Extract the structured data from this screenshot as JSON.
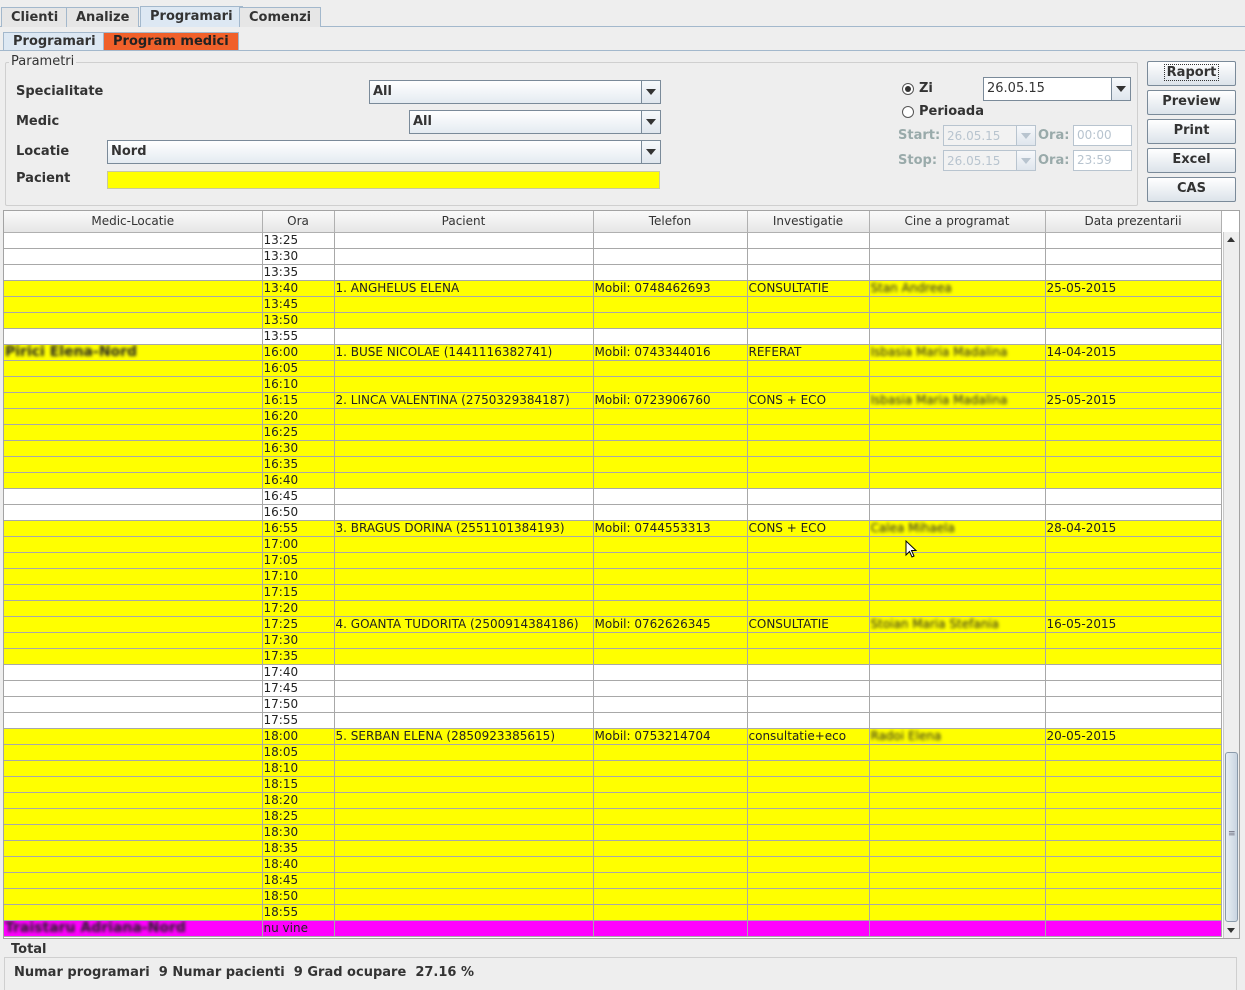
{
  "tabs": {
    "main": [
      "Clienti",
      "Analize",
      "Programari",
      "Comenzi"
    ],
    "sub": [
      "Programari",
      "Program medici"
    ]
  },
  "params": {
    "title": "Parametri",
    "specialitate_label": "Specialitate",
    "specialitate_value": "All",
    "medic_label": "Medic",
    "medic_value": "All",
    "locatie_label": "Locatie",
    "locatie_value": "Nord",
    "pacient_label": "Pacient",
    "zi_label": "Zi",
    "zi_value": "26.05.15",
    "perioada_label": "Perioada",
    "start_label": "Start:",
    "start_value": "26.05.15",
    "stop_label": "Stop:",
    "stop_value": "26.05.15",
    "ora_label": "Ora:",
    "ora_start": "00:00",
    "ora_stop": "23:59"
  },
  "buttons": {
    "raport": "Raport",
    "preview": "Preview",
    "print": "Print",
    "excel": "Excel",
    "cas": "CAS"
  },
  "grid": {
    "columns": [
      "Medic-Locatie",
      "Ora",
      "Pacient",
      "Telefon",
      "Investigatie",
      "Cine a programat",
      "Data prezentarii"
    ],
    "rows": [
      {
        "c": "white",
        "medic": "",
        "ora": "13:25",
        "pacient": "",
        "telefon": "",
        "invest": "",
        "cine": "",
        "data": ""
      },
      {
        "c": "white",
        "medic": "",
        "ora": "13:30",
        "pacient": "",
        "telefon": "",
        "invest": "",
        "cine": "",
        "data": ""
      },
      {
        "c": "white",
        "medic": "",
        "ora": "13:35",
        "pacient": "",
        "telefon": "",
        "invest": "",
        "cine": "",
        "data": ""
      },
      {
        "c": "yellow",
        "medic": "",
        "ora": "13:40",
        "pacient": "1. ANGHELUS ELENA",
        "telefon": "Mobil: 0748462693",
        "invest": "CONSULTATIE",
        "cine": "Stan Andreea",
        "data": "25-05-2015"
      },
      {
        "c": "yellow",
        "medic": "",
        "ora": "13:45",
        "pacient": "",
        "telefon": "",
        "invest": "",
        "cine": "",
        "data": ""
      },
      {
        "c": "yellow",
        "medic": "",
        "ora": "13:50",
        "pacient": "",
        "telefon": "",
        "invest": "",
        "cine": "",
        "data": ""
      },
      {
        "c": "white",
        "medic": "",
        "ora": "13:55",
        "pacient": "",
        "telefon": "",
        "invest": "",
        "cine": "",
        "data": ""
      },
      {
        "c": "yellow",
        "medic": "Pirici Elena-Nord",
        "ora": "16:00",
        "pacient": "1. BUSE NICOLAE (1441116382741)",
        "telefon": "Mobil: 0743344016",
        "invest": "REFERAT",
        "cine": "Isbasia Maria Madalina",
        "data": "14-04-2015"
      },
      {
        "c": "yellow",
        "medic": "",
        "ora": "16:05",
        "pacient": "",
        "telefon": "",
        "invest": "",
        "cine": "",
        "data": ""
      },
      {
        "c": "yellow",
        "medic": "",
        "ora": "16:10",
        "pacient": "",
        "telefon": "",
        "invest": "",
        "cine": "",
        "data": ""
      },
      {
        "c": "yellow",
        "medic": "",
        "ora": "16:15",
        "pacient": "2. LINCA VALENTINA (2750329384187)",
        "telefon": "Mobil: 0723906760",
        "invest": "CONS + ECO",
        "cine": "Isbasia Maria Madalina",
        "data": "25-05-2015"
      },
      {
        "c": "yellow",
        "medic": "",
        "ora": "16:20",
        "pacient": "",
        "telefon": "",
        "invest": "",
        "cine": "",
        "data": ""
      },
      {
        "c": "yellow",
        "medic": "",
        "ora": "16:25",
        "pacient": "",
        "telefon": "",
        "invest": "",
        "cine": "",
        "data": ""
      },
      {
        "c": "yellow",
        "medic": "",
        "ora": "16:30",
        "pacient": "",
        "telefon": "",
        "invest": "",
        "cine": "",
        "data": ""
      },
      {
        "c": "yellow",
        "medic": "",
        "ora": "16:35",
        "pacient": "",
        "telefon": "",
        "invest": "",
        "cine": "",
        "data": ""
      },
      {
        "c": "yellow",
        "medic": "",
        "ora": "16:40",
        "pacient": "",
        "telefon": "",
        "invest": "",
        "cine": "",
        "data": ""
      },
      {
        "c": "white",
        "medic": "",
        "ora": "16:45",
        "pacient": "",
        "telefon": "",
        "invest": "",
        "cine": "",
        "data": ""
      },
      {
        "c": "white",
        "medic": "",
        "ora": "16:50",
        "pacient": "",
        "telefon": "",
        "invest": "",
        "cine": "",
        "data": ""
      },
      {
        "c": "yellow",
        "medic": "",
        "ora": "16:55",
        "pacient": "3. BRAGUS DORINA (2551101384193)",
        "telefon": "Mobil: 0744553313",
        "invest": "CONS + ECO",
        "cine": "Calea Mihaela",
        "data": "28-04-2015"
      },
      {
        "c": "yellow",
        "medic": "",
        "ora": "17:00",
        "pacient": "",
        "telefon": "",
        "invest": "",
        "cine": "",
        "data": ""
      },
      {
        "c": "yellow",
        "medic": "",
        "ora": "17:05",
        "pacient": "",
        "telefon": "",
        "invest": "",
        "cine": "",
        "data": ""
      },
      {
        "c": "yellow",
        "medic": "",
        "ora": "17:10",
        "pacient": "",
        "telefon": "",
        "invest": "",
        "cine": "",
        "data": ""
      },
      {
        "c": "yellow",
        "medic": "",
        "ora": "17:15",
        "pacient": "",
        "telefon": "",
        "invest": "",
        "cine": "",
        "data": ""
      },
      {
        "c": "yellow",
        "medic": "",
        "ora": "17:20",
        "pacient": "",
        "telefon": "",
        "invest": "",
        "cine": "",
        "data": ""
      },
      {
        "c": "yellow",
        "medic": "",
        "ora": "17:25",
        "pacient": "4. GOANTA TUDORITA (2500914384186)",
        "telefon": "Mobil: 0762626345",
        "invest": "CONSULTATIE",
        "cine": "Stoian Maria Stefania",
        "data": "16-05-2015"
      },
      {
        "c": "yellow",
        "medic": "",
        "ora": "17:30",
        "pacient": "",
        "telefon": "",
        "invest": "",
        "cine": "",
        "data": ""
      },
      {
        "c": "yellow",
        "medic": "",
        "ora": "17:35",
        "pacient": "",
        "telefon": "",
        "invest": "",
        "cine": "",
        "data": ""
      },
      {
        "c": "white",
        "medic": "",
        "ora": "17:40",
        "pacient": "",
        "telefon": "",
        "invest": "",
        "cine": "",
        "data": ""
      },
      {
        "c": "white",
        "medic": "",
        "ora": "17:45",
        "pacient": "",
        "telefon": "",
        "invest": "",
        "cine": "",
        "data": ""
      },
      {
        "c": "white",
        "medic": "",
        "ora": "17:50",
        "pacient": "",
        "telefon": "",
        "invest": "",
        "cine": "",
        "data": ""
      },
      {
        "c": "white",
        "medic": "",
        "ora": "17:55",
        "pacient": "",
        "telefon": "",
        "invest": "",
        "cine": "",
        "data": ""
      },
      {
        "c": "yellow",
        "medic": "",
        "ora": "18:00",
        "pacient": "5. SERBAN ELENA (2850923385615)",
        "telefon": "Mobil: 0753214704",
        "invest": "consultatie+eco",
        "cine": "Radoi Elena",
        "data": "20-05-2015"
      },
      {
        "c": "yellow",
        "medic": "",
        "ora": "18:05",
        "pacient": "",
        "telefon": "",
        "invest": "",
        "cine": "",
        "data": ""
      },
      {
        "c": "yellow",
        "medic": "",
        "ora": "18:10",
        "pacient": "",
        "telefon": "",
        "invest": "",
        "cine": "",
        "data": ""
      },
      {
        "c": "yellow",
        "medic": "",
        "ora": "18:15",
        "pacient": "",
        "telefon": "",
        "invest": "",
        "cine": "",
        "data": ""
      },
      {
        "c": "yellow",
        "medic": "",
        "ora": "18:20",
        "pacient": "",
        "telefon": "",
        "invest": "",
        "cine": "",
        "data": ""
      },
      {
        "c": "yellow",
        "medic": "",
        "ora": "18:25",
        "pacient": "",
        "telefon": "",
        "invest": "",
        "cine": "",
        "data": ""
      },
      {
        "c": "yellow",
        "medic": "",
        "ora": "18:30",
        "pacient": "",
        "telefon": "",
        "invest": "",
        "cine": "",
        "data": ""
      },
      {
        "c": "yellow",
        "medic": "",
        "ora": "18:35",
        "pacient": "",
        "telefon": "",
        "invest": "",
        "cine": "",
        "data": ""
      },
      {
        "c": "yellow",
        "medic": "",
        "ora": "18:40",
        "pacient": "",
        "telefon": "",
        "invest": "",
        "cine": "",
        "data": ""
      },
      {
        "c": "yellow",
        "medic": "",
        "ora": "18:45",
        "pacient": "",
        "telefon": "",
        "invest": "",
        "cine": "",
        "data": ""
      },
      {
        "c": "yellow",
        "medic": "",
        "ora": "18:50",
        "pacient": "",
        "telefon": "",
        "invest": "",
        "cine": "",
        "data": ""
      },
      {
        "c": "yellow",
        "medic": "",
        "ora": "18:55",
        "pacient": "",
        "telefon": "",
        "invest": "",
        "cine": "",
        "data": ""
      },
      {
        "c": "magenta",
        "medic": "Traistaru Adriana-Nord",
        "ora": "nu vine",
        "pacient": "",
        "telefon": "",
        "invest": "",
        "cine": "",
        "data": ""
      }
    ]
  },
  "total": {
    "title": "Total",
    "numar_programari_label": "Numar programari",
    "numar_programari": "9",
    "numar_pacienti_label": "Numar pacienti",
    "numar_pacienti": "9",
    "grad_ocupare_label": "Grad ocupare",
    "grad_ocupare": "27.16 %"
  },
  "colors": {
    "booked": "#ffff00",
    "free": "#ffffff",
    "absent": "#ff00ff",
    "active_subtab": "#f0602a"
  }
}
